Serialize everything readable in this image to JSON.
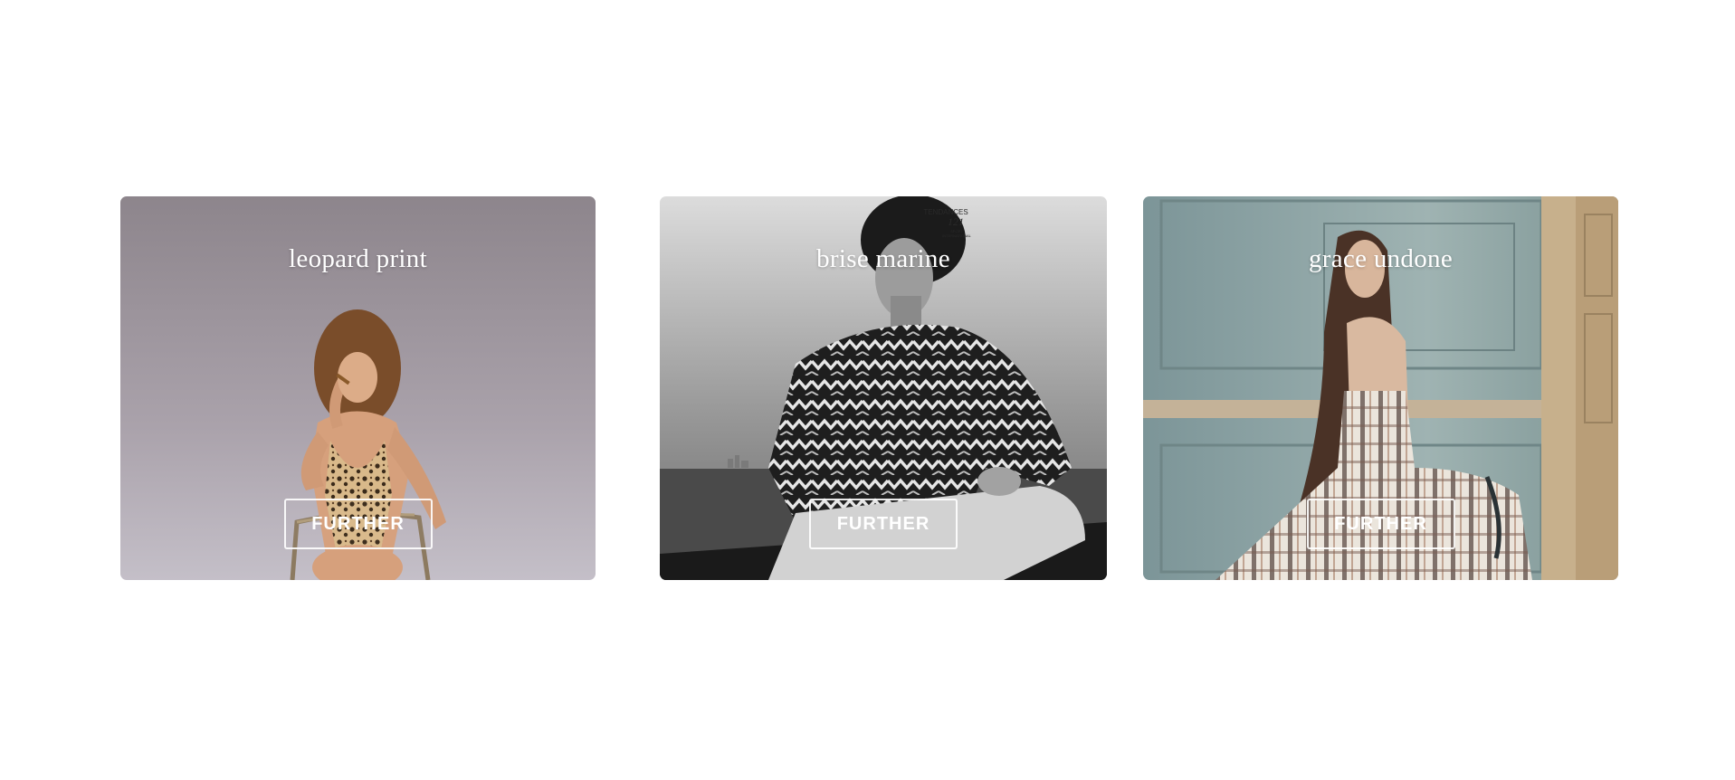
{
  "cards": [
    {
      "title": "leopard print",
      "button_label": "FURTHER",
      "image": "woman-in-leopard-swimsuit-photo"
    },
    {
      "title": "brise marine",
      "button_label": "FURTHER",
      "image": "man-in-zigzag-sweater-on-boat-photo",
      "magazine_mark": [
        "TENDANCES",
        "121",
        "SPORT",
        "INTERNATIONAL"
      ]
    },
    {
      "title": "grace undone",
      "button_label": "FURTHER",
      "image": "woman-in-plaid-dress-photo"
    }
  ]
}
